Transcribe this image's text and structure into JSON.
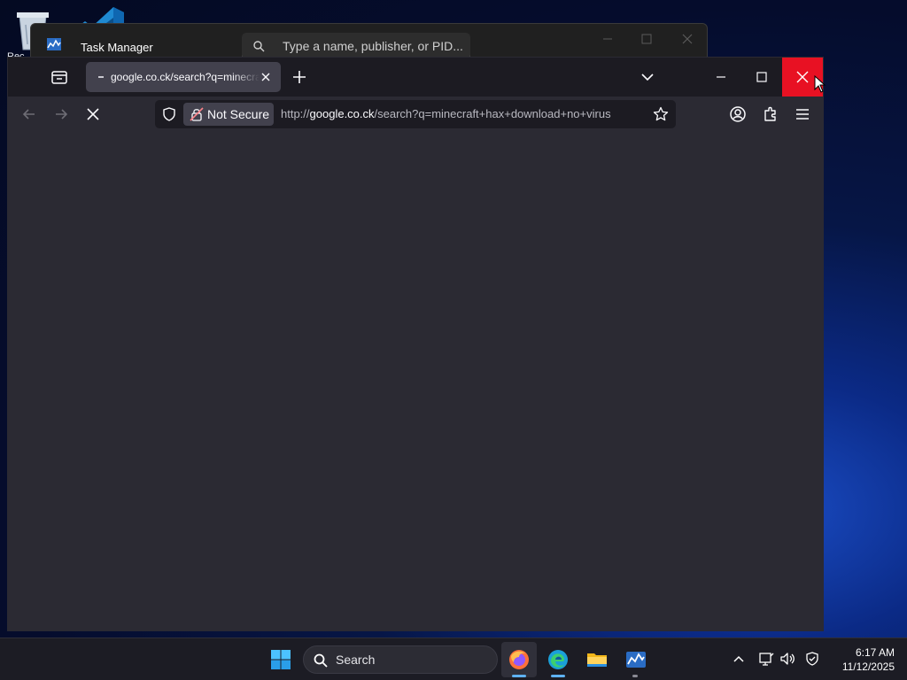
{
  "desktop": {
    "recycle_label": "Rec"
  },
  "task_manager": {
    "title": "Task Manager",
    "search_placeholder": "Type a name, publisher, or PID..."
  },
  "browser": {
    "tab": {
      "title": "google.co.ck/search?q=minecraft+hax+download+no+virus"
    },
    "urlbar": {
      "security_label": "Not Secure",
      "url_prefix": "http://",
      "url_host": "google.co.ck",
      "url_path": "/search?q=minecraft+hax+download+no+virus"
    },
    "colors": {
      "close_hover": "#e81123",
      "toolbar": "#2b2a33",
      "tabbar": "#1c1b22",
      "selected_tab": "#42414d"
    }
  },
  "taskbar": {
    "search_label": "Search",
    "apps": [
      "firefox-icon",
      "edge-icon",
      "file-explorer-icon",
      "task-manager-icon"
    ],
    "clock": {
      "time": "6:17 AM",
      "date": "11/12/2025"
    },
    "accent": "#5fb2f2"
  }
}
